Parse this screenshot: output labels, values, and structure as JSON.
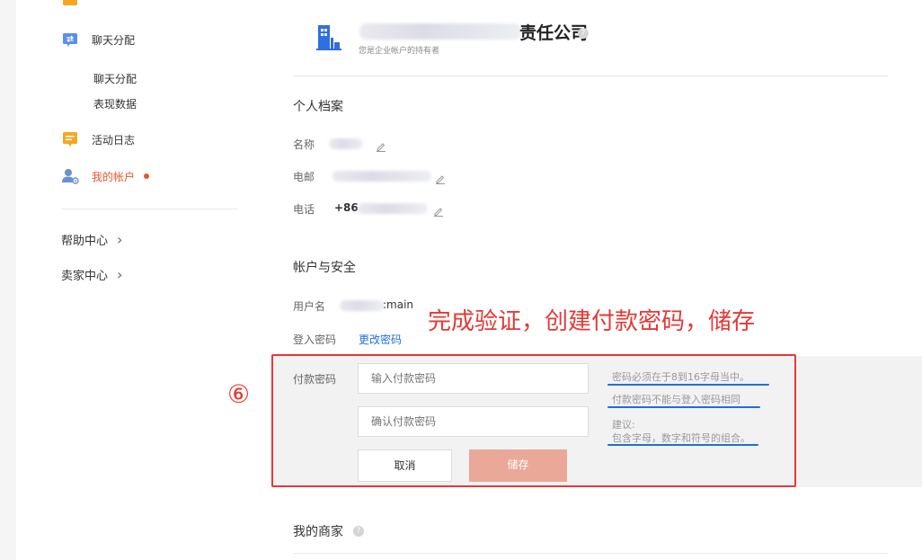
{
  "sidebar": {
    "items": [
      {
        "label": "聊天分配",
        "icon": "chat-assign-icon"
      },
      {
        "label": "活动日志",
        "icon": "activity-log-icon"
      },
      {
        "label": "我的帐户",
        "icon": "account-icon"
      }
    ],
    "sub_items": [
      "聊天分配",
      "表现数据"
    ],
    "help_center": "帮助中心",
    "seller_center": "卖家中心",
    "chevron": "›"
  },
  "company": {
    "name_suffix": "责任公司",
    "owner_note": "您是企业帐户的持有者"
  },
  "profile": {
    "title": "个人档案",
    "name_label": "名称",
    "email_label": "电邮",
    "phone_label": "电话",
    "phone_prefix": "+86"
  },
  "security": {
    "title": "帐户与安全",
    "username_label": "用户名",
    "username_suffix": ":main",
    "login_password_label": "登入密码",
    "change_password_link": "更改密码"
  },
  "payment": {
    "label": "付款密码",
    "input_placeholder": "输入付款密码",
    "confirm_placeholder": "确认付款密码",
    "cancel": "取消",
    "save": "储存",
    "hints": {
      "length": "密码必须在于8到16字母当中。",
      "different": "付款密码不能与登入密码相同",
      "suggest_title": "建议:",
      "suggest_body": "包含字母，数字和符号的组合。"
    }
  },
  "merchant": {
    "title": "我的商家"
  },
  "annotation": {
    "step": "⑥",
    "instruction": "完成验证，创建付款密码，储存",
    "color": "#e53935"
  },
  "colors": {
    "accent_orange": "#f5a623",
    "accent_blue": "#3b82f6",
    "link_blue": "#1e6fd9",
    "active_red": "#e4572e",
    "save_button": "#e9a898"
  }
}
